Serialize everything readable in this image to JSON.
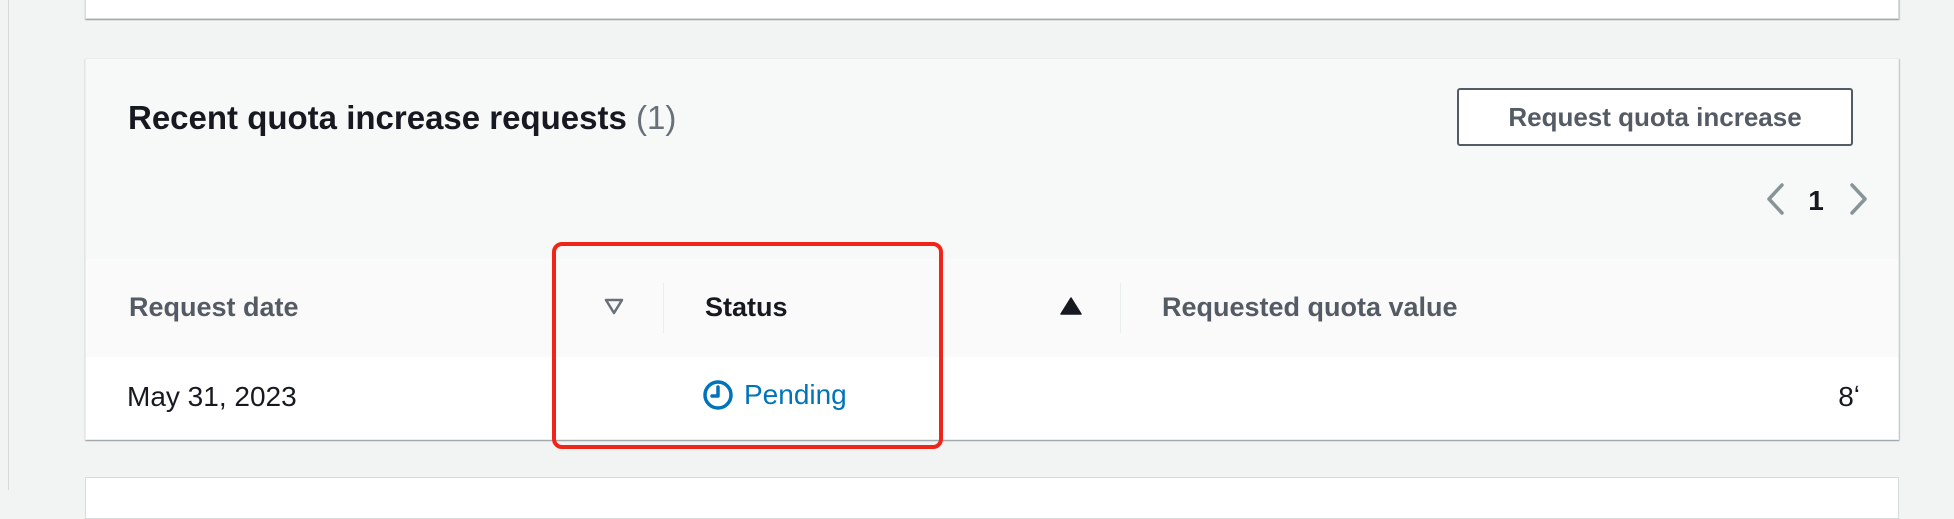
{
  "quota_requests": {
    "title": "Recent quota increase requests",
    "count": "(1)",
    "request_button_label": "Request quota increase",
    "pagination": {
      "current_page": "1",
      "prev_icon": "chevron-left-icon",
      "next_icon": "chevron-right-icon"
    },
    "table": {
      "columns": [
        {
          "label": "Request date",
          "sort": "descending-inactive"
        },
        {
          "label": "Status",
          "sort": "ascending-active"
        },
        {
          "label": "Requested quota value"
        }
      ],
      "rows": [
        {
          "request_date": "May 31, 2023",
          "status": "Pending",
          "status_icon": "clock-icon",
          "requested_value": "8ʻ"
        }
      ]
    }
  },
  "colors": {
    "status_link": "#0073bb",
    "highlight": "#f0251a",
    "header_bg": "#f7f8f8"
  }
}
